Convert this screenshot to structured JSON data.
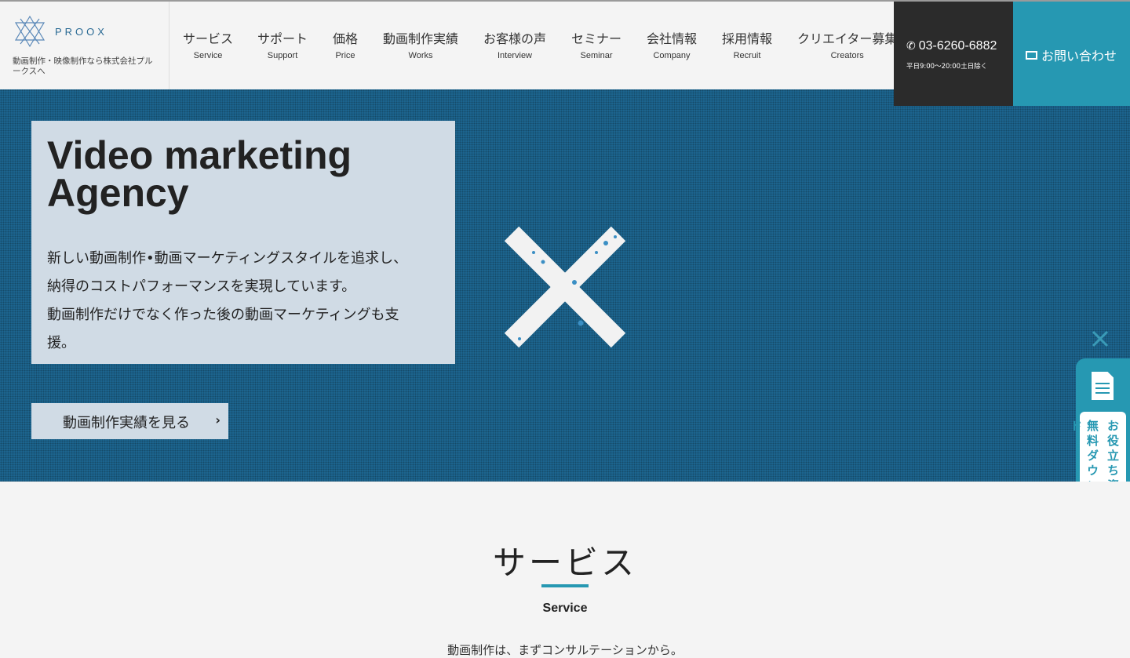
{
  "brand": {
    "logo_text": "PROOX",
    "tagline": "動画制作・映像制作なら株式会社プルークスへ"
  },
  "nav": [
    {
      "jp": "サービス",
      "en": "Service"
    },
    {
      "jp": "サポート",
      "en": "Support"
    },
    {
      "jp": "価格",
      "en": "Price"
    },
    {
      "jp": "動画制作実績",
      "en": "Works"
    },
    {
      "jp": "お客様の声",
      "en": "Interview"
    },
    {
      "jp": "セミナー",
      "en": "Seminar"
    },
    {
      "jp": "会社情報",
      "en": "Company"
    },
    {
      "jp": "採用情報",
      "en": "Recruit"
    },
    {
      "jp": "クリエイター募集",
      "en": "Creators"
    }
  ],
  "phone": {
    "number": "03-6260-6882",
    "hours": "平日9:00〜20:00土日除く"
  },
  "contact": {
    "label": "お問い合わせ"
  },
  "hero": {
    "title": "Video marketing Agency",
    "body_lines": [
      "新しい動画制作•動画マーケティングスタイルを追求し、",
      "納得のコストパフォーマンスを実現しています。",
      "動画制作だけでなく作った後の動画マーケティングも支",
      "援。"
    ],
    "cta_label": "動画制作実績を見る"
  },
  "side_tab": {
    "line1": "お役立ち資料",
    "line2": "無料ダウンロード"
  },
  "service": {
    "title": "サービス",
    "subtitle": "Service",
    "description": "動画制作は、まずコンサルテーションから。"
  },
  "colors": {
    "accent": "#2698b2",
    "hero_bg": "#1d6690",
    "phone_bg": "#2b2b2b",
    "card_bg": "#d0dbe5"
  },
  "icons": {
    "phone": "phone-icon",
    "mail": "mail-icon",
    "chevron": "chevron-right-icon",
    "document": "document-icon",
    "close": "close-icon"
  }
}
